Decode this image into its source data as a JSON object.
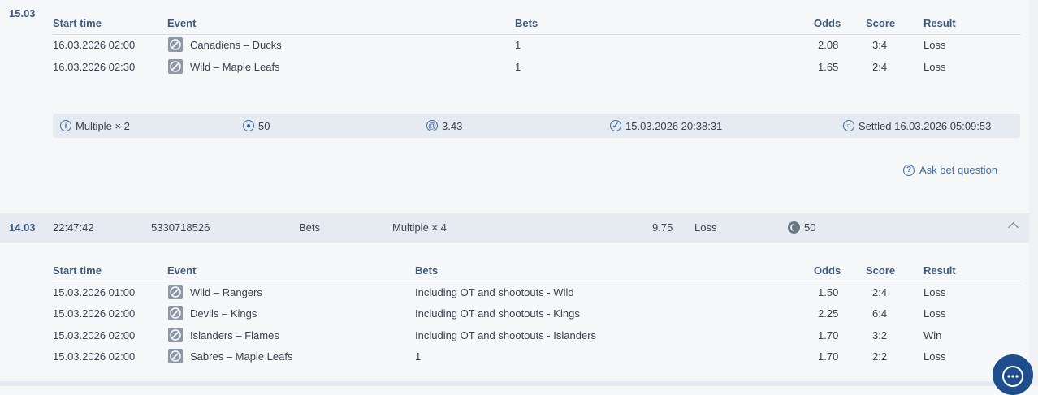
{
  "colors": {
    "accent": "#3d5a80",
    "link": "#3d6fa8",
    "icon_bg": "#8d99a8",
    "row_bg": "#e6ebf2",
    "chat": "#1e4e8c"
  },
  "group1": {
    "date": "15.03",
    "headers": {
      "start": "Start time",
      "event": "Event",
      "bets": "Bets",
      "odds": "Odds",
      "score": "Score",
      "result": "Result"
    },
    "rows": [
      {
        "start": "16.03.2026 02:00",
        "event": "Canadiens – Ducks",
        "bets": "1",
        "odds": "2.08",
        "score": "3:4",
        "result": "Loss",
        "icon": "hockey-puck-icon"
      },
      {
        "start": "16.03.2026 02:30",
        "event": "Wild – Maple Leafs",
        "bets": "1",
        "odds": "1.65",
        "score": "2:4",
        "result": "Loss",
        "icon": "hockey-puck-icon"
      }
    ],
    "summary": {
      "type": "Multiple × 2",
      "stake": "50",
      "odds": "3.43",
      "placed": "15.03.2026 20:38:31",
      "settled": "Settled 16.03.2026 05:09:53"
    },
    "ask": "Ask bet question"
  },
  "bet2": {
    "date": "14.03",
    "time": "22:47:42",
    "id": "5330718526",
    "kind": "Bets",
    "type": "Multiple × 4",
    "odds": "9.75",
    "result": "Loss",
    "stake": "50"
  },
  "group2": {
    "headers": {
      "start": "Start time",
      "event": "Event",
      "bets": "Bets",
      "odds": "Odds",
      "score": "Score",
      "result": "Result"
    },
    "rows": [
      {
        "start": "15.03.2026 01:00",
        "event": "Wild – Rangers",
        "bets": "Including OT and shootouts - Wild",
        "odds": "1.50",
        "score": "2:4",
        "result": "Loss"
      },
      {
        "start": "15.03.2026 02:00",
        "event": "Devils – Kings",
        "bets": "Including OT and shootouts - Kings",
        "odds": "2.25",
        "score": "6:4",
        "result": "Loss"
      },
      {
        "start": "15.03.2026 02:00",
        "event": "Islanders – Flames",
        "bets": "Including OT and shootouts - Islanders",
        "odds": "1.70",
        "score": "3:2",
        "result": "Win"
      },
      {
        "start": "15.03.2026 02:00",
        "event": "Sabres – Maple Leafs",
        "bets": "1",
        "odds": "1.70",
        "score": "2:2",
        "result": "Loss"
      }
    ]
  }
}
